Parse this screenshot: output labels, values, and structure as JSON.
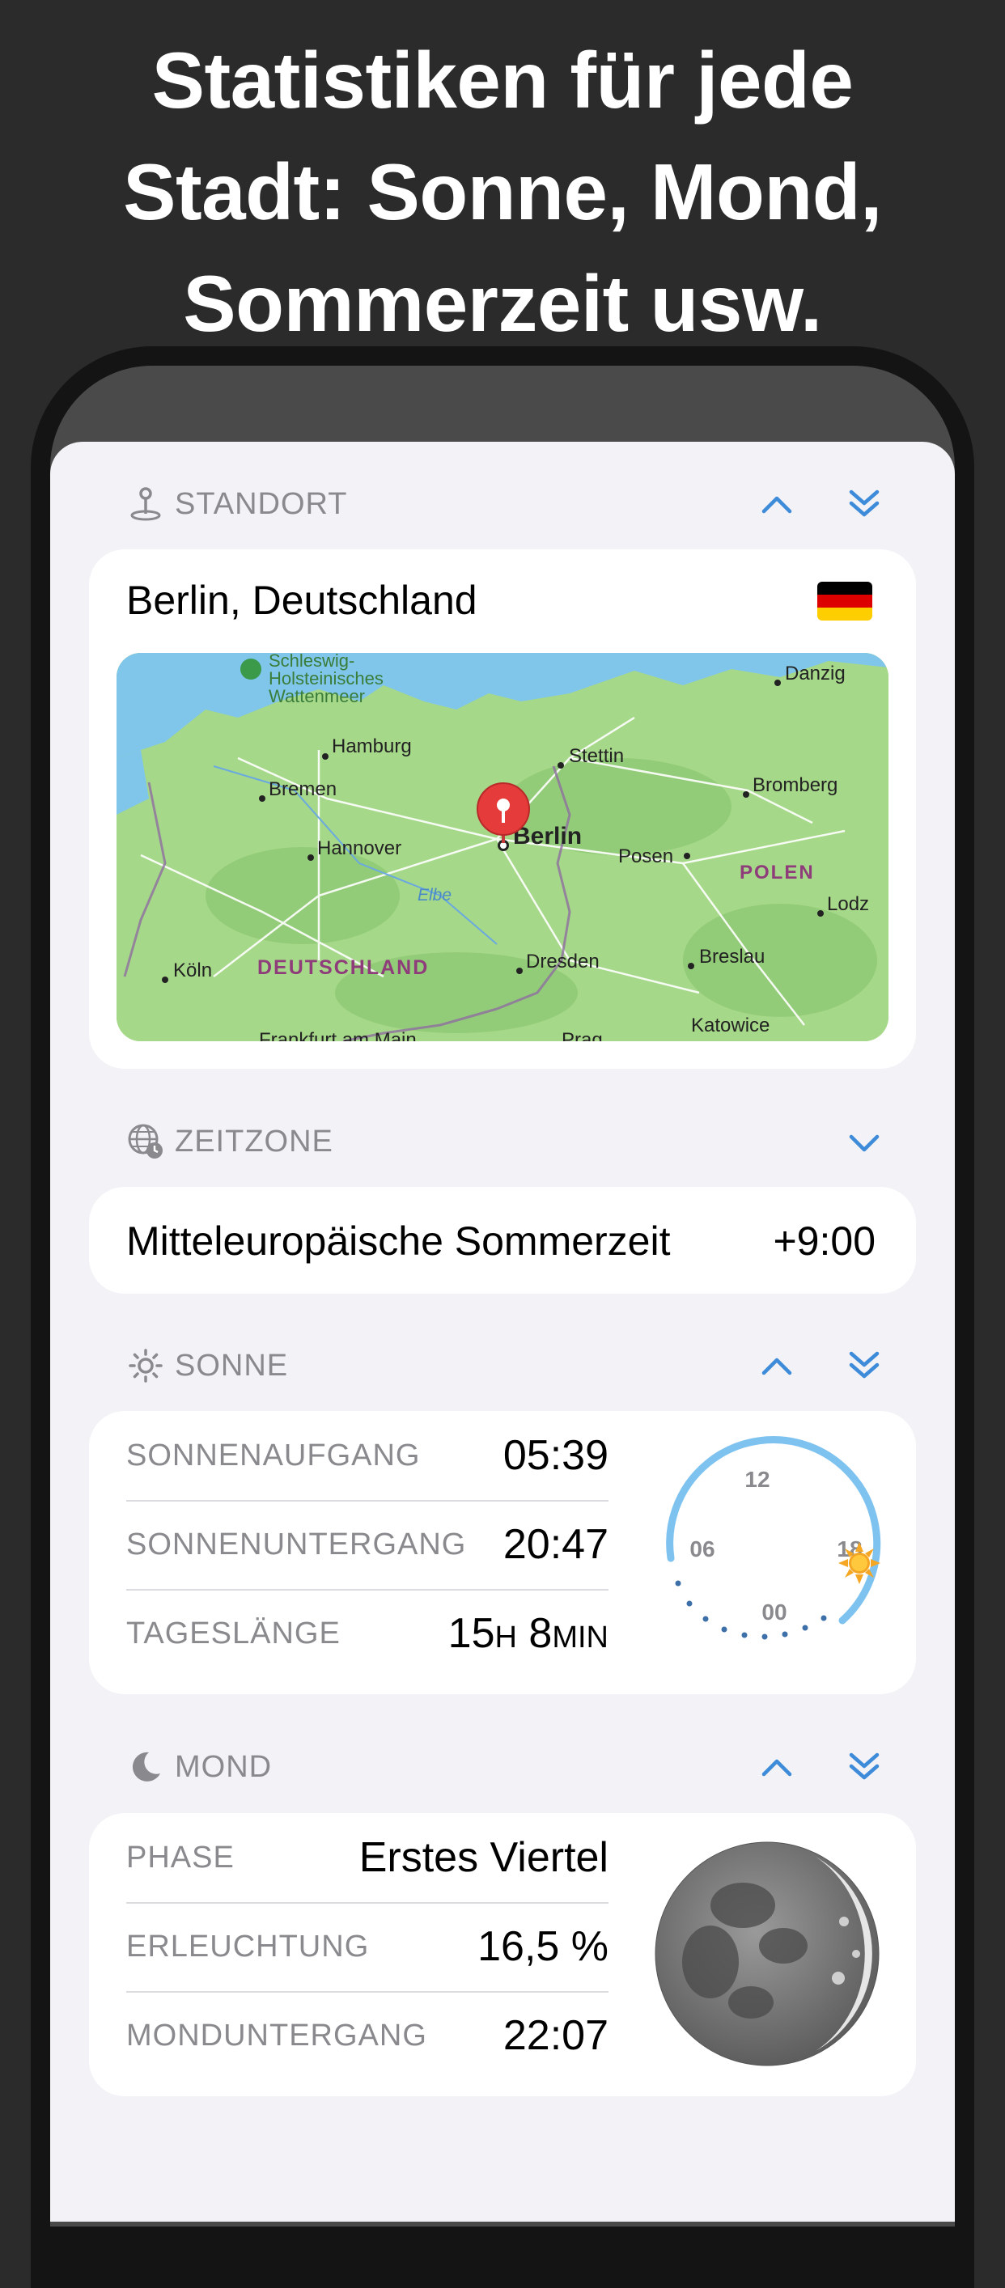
{
  "headline": {
    "line1": "Statistiken für jede",
    "line2": "Stadt: Sonne, Mond,",
    "line3": "Sommerzeit usw."
  },
  "location": {
    "section_label": "STANDORT",
    "city": "Berlin, Deutschland",
    "map": {
      "cities": [
        "Hamburg",
        "Bremen",
        "Hannover",
        "Berlin",
        "Stettin",
        "Danzig",
        "Bromberg",
        "Posen",
        "Lodz",
        "Breslau",
        "Dresden",
        "Köln",
        "Katowice",
        "Frankfurt am Main",
        "Prag"
      ],
      "regions": [
        "Schleswig-Holsteinisches Wattenmeer",
        "DEUTSCHLAND",
        "POLEN"
      ],
      "river": "Elbe"
    }
  },
  "timezone": {
    "section_label": "ZEITZONE",
    "name": "Mitteleuropäische Sommerzeit",
    "offset": "+9:00"
  },
  "sun": {
    "section_label": "SONNE",
    "rows": [
      {
        "label": "SONNENAUFGANG",
        "value": "05:39"
      },
      {
        "label": "SONNENUNTERGANG",
        "value": "20:47"
      },
      {
        "label": "TAGESLÄNGE",
        "value_h": "15",
        "unit_h": "H",
        "value_m": "8",
        "unit_m": "MIN"
      }
    ],
    "dial": {
      "top": "12",
      "left": "06",
      "right": "18",
      "bottom": "00"
    }
  },
  "moon": {
    "section_label": "MOND",
    "rows": [
      {
        "label": "PHASE",
        "value": "Erstes Viertel"
      },
      {
        "label": "ERLEUCHTUNG",
        "value": "16,5 %"
      },
      {
        "label": "MONDUNTERGANG",
        "value": "22:07"
      }
    ]
  },
  "colors": {
    "accent": "#3d8bd9",
    "sun_arc": "#7ec3f0",
    "label_gray": "#8a8a8e"
  }
}
